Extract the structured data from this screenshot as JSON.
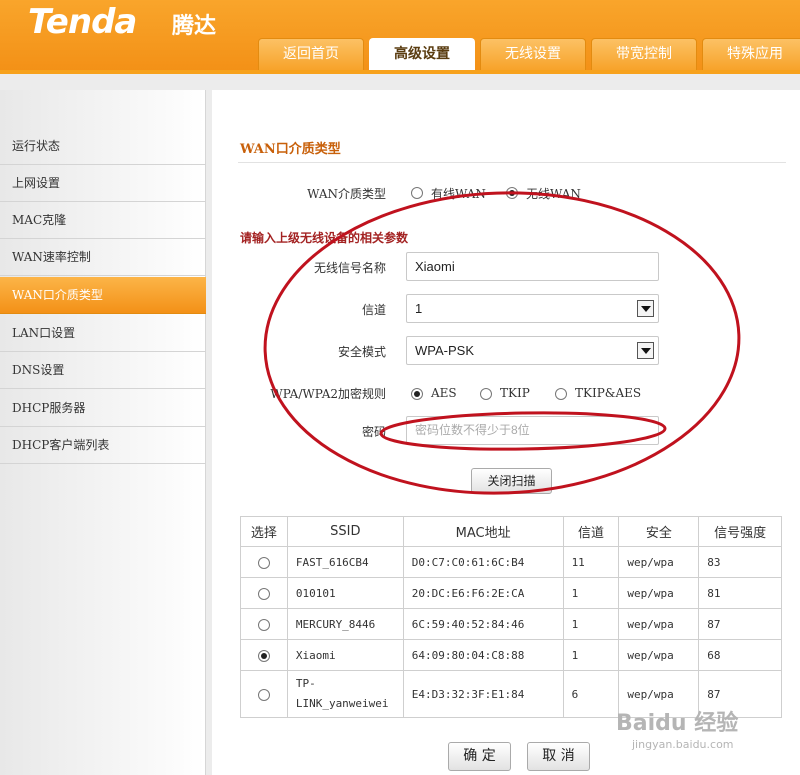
{
  "brand": {
    "logo": "Tenda",
    "logo_cn": "腾达"
  },
  "tabs": [
    {
      "label": "返回首页",
      "active": false
    },
    {
      "label": "高级设置",
      "active": true
    },
    {
      "label": "无线设置",
      "active": false
    },
    {
      "label": "带宽控制",
      "active": false
    },
    {
      "label": "特殊应用",
      "active": false
    }
  ],
  "sidebar": {
    "items": [
      {
        "label": "运行状态"
      },
      {
        "label": "上网设置"
      },
      {
        "label": "MAC克隆"
      },
      {
        "label": "WAN速率控制"
      },
      {
        "label": "WAN口介质类型",
        "active": true
      },
      {
        "label": "LAN口设置"
      },
      {
        "label": "DNS设置"
      },
      {
        "label": "DHCP服务器"
      },
      {
        "label": "DHCP客户端列表"
      }
    ]
  },
  "main": {
    "section_title": "WAN口介质类型",
    "wan_medium": {
      "label": "WAN介质类型",
      "options": [
        "有线WAN",
        "无线WAN"
      ],
      "selected": "无线WAN"
    },
    "subhead": "请输入上级无线设备的相关参数",
    "ssid": {
      "label": "无线信号名称",
      "value": "Xiaomi"
    },
    "channel": {
      "label": "信道",
      "value": "1"
    },
    "security_mode": {
      "label": "安全模式",
      "value": "WPA-PSK"
    },
    "encryption": {
      "label": "WPA/WPA2加密规则",
      "options": [
        "AES",
        "TKIP",
        "TKIP&AES"
      ],
      "selected": "AES"
    },
    "password": {
      "label": "密码",
      "placeholder": "密码位数不得少于8位"
    },
    "close_scan_button": "关闭扫描",
    "scan_table": {
      "headers": [
        "选择",
        "SSID",
        "MAC地址",
        "信道",
        "安全",
        "信号强度"
      ],
      "rows": [
        {
          "ssid": "FAST_616CB4",
          "mac": "D0:C7:C0:61:6C:B4",
          "channel": "11",
          "security": "wep/wpa",
          "signal": "83",
          "selected": false
        },
        {
          "ssid": "010101",
          "mac": "20:DC:E6:F6:2E:CA",
          "channel": "1",
          "security": "wep/wpa",
          "signal": "81",
          "selected": false
        },
        {
          "ssid": "MERCURY_8446",
          "mac": "6C:59:40:52:84:46",
          "channel": "1",
          "security": "wep/wpa",
          "signal": "87",
          "selected": false
        },
        {
          "ssid": "Xiaomi",
          "mac": "64:09:80:04:C8:88",
          "channel": "1",
          "security": "wep/wpa",
          "signal": "68",
          "selected": true
        },
        {
          "ssid": "TP-LINK_yanweiwei",
          "mac": "E4:D3:32:3F:E1:84",
          "channel": "6",
          "security": "wep/wpa",
          "signal": "87",
          "selected": false
        }
      ]
    },
    "ok_button": "确 定",
    "cancel_button": "取 消"
  },
  "watermark": {
    "text": "Baidu 经验",
    "sub": "jingyan.baidu.com"
  },
  "colors": {
    "brand_orange": "#f39117",
    "title_orange": "#c8600a",
    "subhead_red": "#a32222",
    "annotation_red": "#c0121e"
  }
}
